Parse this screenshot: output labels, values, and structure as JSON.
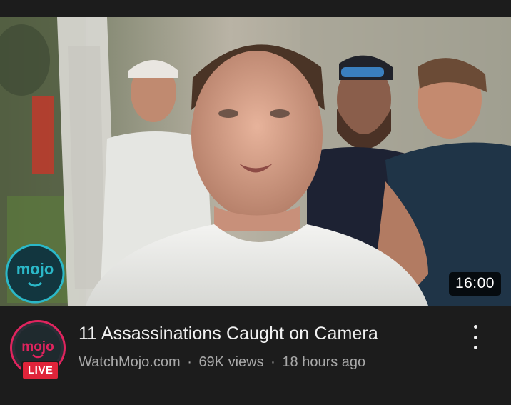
{
  "video": {
    "title": "11 Assassinations Caught on Camera",
    "duration": "16:00",
    "channel": "WatchMojo.com",
    "views": "69K views",
    "age": "18 hours ago",
    "separator": "·"
  },
  "channel_avatar": {
    "logo_text": "mojo",
    "live_label": "LIVE"
  },
  "thumbnail": {
    "watermark_text": "mojo"
  },
  "icons": {
    "menu": "more-vert-icon"
  },
  "colors": {
    "background": "#1c1c1c",
    "live_red": "#e0243a",
    "ring_pink": "#e0245e",
    "mojo_teal": "#2bb8c8",
    "title": "#f1f1f1",
    "meta": "#a8a8a8"
  }
}
